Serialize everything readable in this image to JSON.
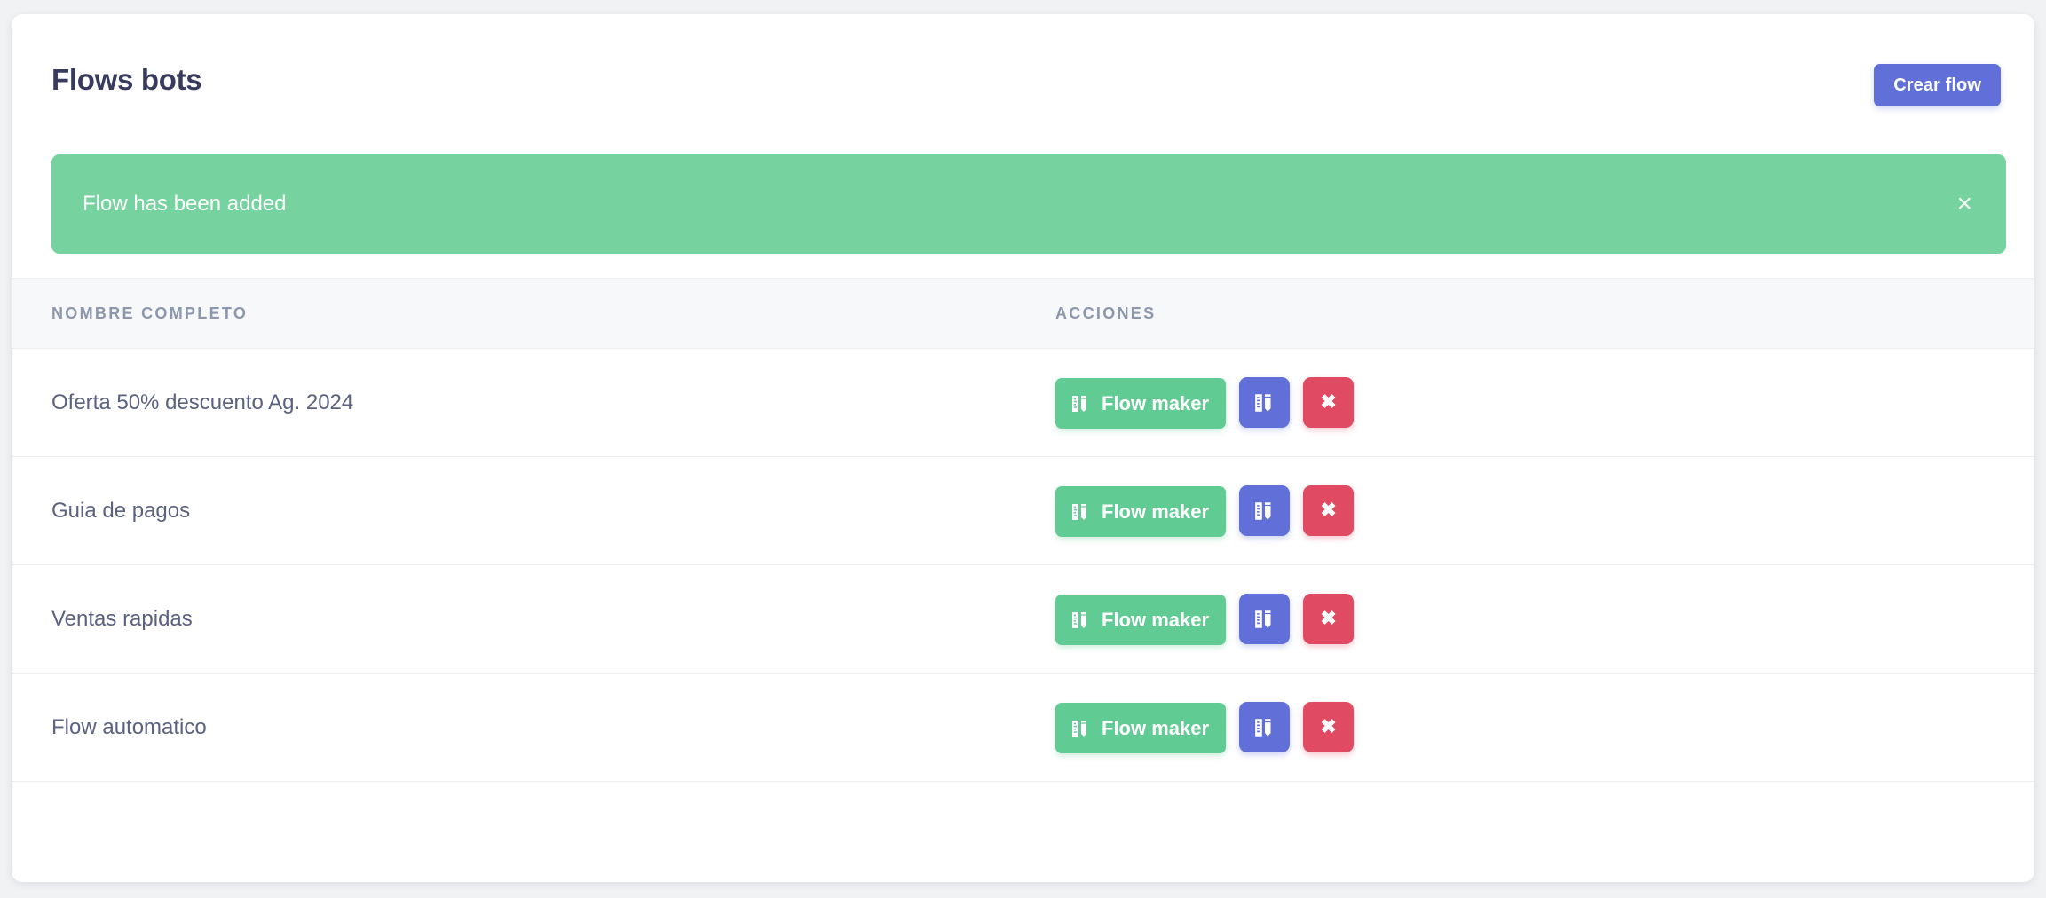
{
  "header": {
    "title": "Flows bots",
    "create_button_label": "Crear flow"
  },
  "alert": {
    "message": "Flow has been added",
    "close_label": "×",
    "type": "success",
    "background_color": "#76d3a0"
  },
  "table": {
    "columns": [
      {
        "key": "name",
        "label": "NOMBRE COMPLETO"
      },
      {
        "key": "actions",
        "label": "ACCIONES"
      }
    ],
    "rows": [
      {
        "name": "Oferta 50% descuento Ag. 2024",
        "maker_label": "Flow maker",
        "delete_label": "✖"
      },
      {
        "name": "Guia de pagos",
        "maker_label": "Flow maker",
        "delete_label": "✖"
      },
      {
        "name": "Ventas rapidas",
        "maker_label": "Flow maker",
        "delete_label": "✖"
      },
      {
        "name": "Flow automatico",
        "maker_label": "Flow maker",
        "delete_label": "✖"
      }
    ]
  },
  "colors": {
    "page_background": "#f1f2f4",
    "card_background": "#ffffff",
    "primary": "#6070d8",
    "success": "#60cb93",
    "danger": "#e04a63",
    "title_text": "#393b5e",
    "body_text": "#5b6180",
    "header_text": "#8c97ad",
    "table_head_background": "#f7f8fa"
  },
  "icons": {
    "maker": "pencil-ruler-icon",
    "edit": "pencil-ruler-icon",
    "delete": "times-icon",
    "alert_close": "close-icon"
  }
}
